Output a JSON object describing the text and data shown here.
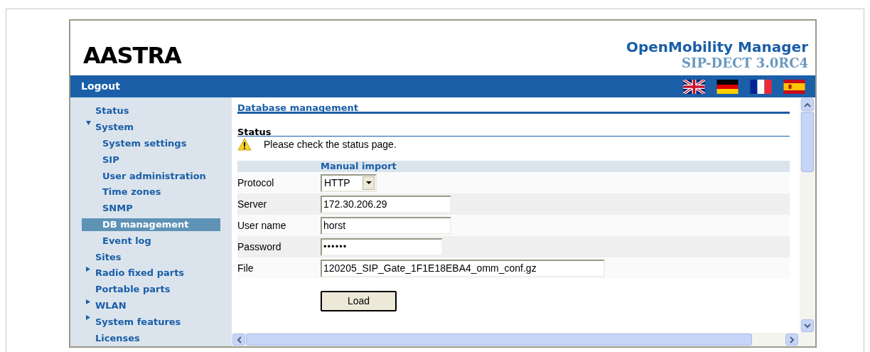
{
  "header": {
    "logo": "AASTRA",
    "title": "OpenMobility Manager",
    "subtitle": "SIP-DECT 3.0RC4"
  },
  "topbar": {
    "logout": "Logout"
  },
  "sidebar": {
    "items": [
      {
        "label": "Status",
        "selected": false
      },
      {
        "label": "System",
        "expanded": true,
        "selected": false,
        "children": [
          {
            "label": "System settings",
            "selected": false
          },
          {
            "label": "SIP",
            "selected": false
          },
          {
            "label": "User administration",
            "selected": false
          },
          {
            "label": "Time zones",
            "selected": false
          },
          {
            "label": "SNMP",
            "selected": false
          },
          {
            "label": "DB management",
            "selected": true
          },
          {
            "label": "Event log",
            "selected": false
          }
        ]
      },
      {
        "label": "Sites",
        "selected": false
      },
      {
        "label": "Radio fixed parts",
        "expanded": false,
        "selected": false
      },
      {
        "label": "Portable parts",
        "selected": false
      },
      {
        "label": "WLAN",
        "expanded": false,
        "selected": false
      },
      {
        "label": "System features",
        "expanded": false,
        "selected": false
      },
      {
        "label": "Licenses",
        "selected": false
      }
    ]
  },
  "content": {
    "title": "Database management",
    "status": {
      "heading": "Status",
      "message": "Please check the status page."
    },
    "form": {
      "heading": "Manual import",
      "rows": [
        {
          "label": "Protocol",
          "kind": "select",
          "value": "HTTP"
        },
        {
          "label": "Server",
          "kind": "text",
          "value": "172.30.206.29"
        },
        {
          "label": "User name",
          "kind": "text",
          "value": "horst"
        },
        {
          "label": "Password",
          "kind": "password",
          "value": "••••••"
        },
        {
          "label": "File",
          "kind": "text",
          "value": "120205_SIP_Gate_1F1E18EBA4_omm_conf.gz"
        }
      ],
      "button": "Load"
    }
  }
}
